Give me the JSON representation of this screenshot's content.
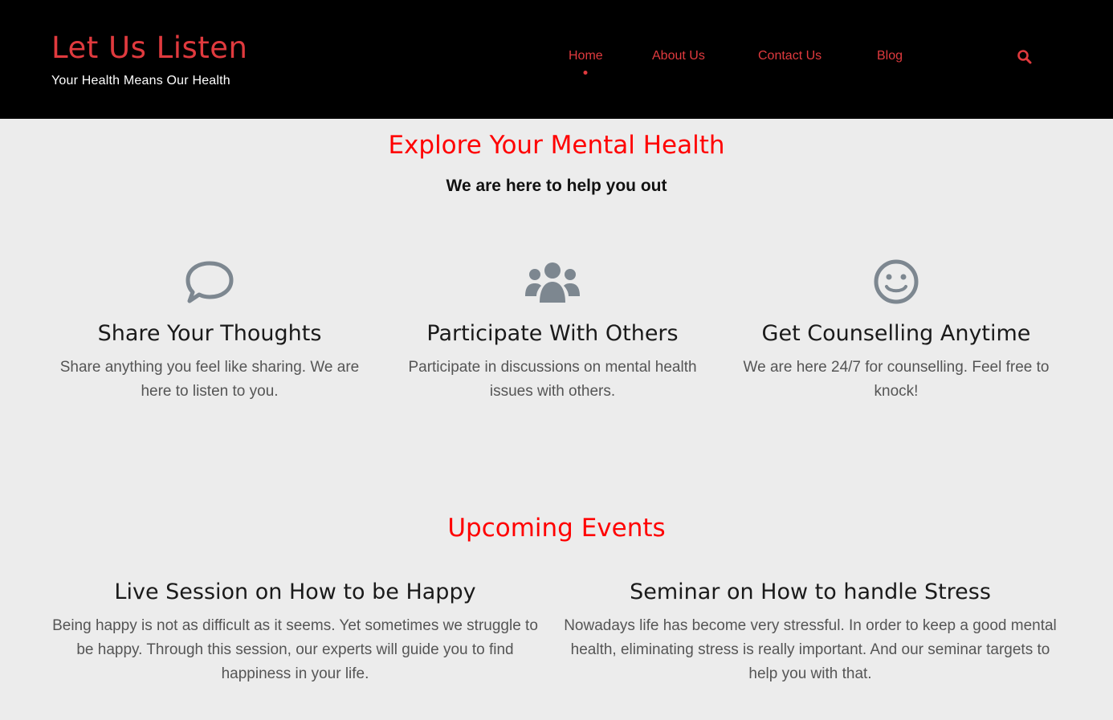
{
  "brand": {
    "title": "Let Us Listen",
    "tagline": "Your Health Means Our Health"
  },
  "nav": {
    "items": [
      {
        "label": "Home",
        "active": true
      },
      {
        "label": "About Us",
        "active": false
      },
      {
        "label": "Contact Us",
        "active": false
      },
      {
        "label": "Blog",
        "active": false
      }
    ],
    "search_icon": "search-icon"
  },
  "explore": {
    "title": "Explore Your Mental Health",
    "subtitle": "We are here to help you out",
    "features": [
      {
        "icon": "speech-bubble-icon",
        "title": "Share Your Thoughts",
        "text": "Share anything you feel like sharing. We are here to listen to you."
      },
      {
        "icon": "users-group-icon",
        "title": "Participate With Others",
        "text": "Participate in discussions on mental health issues with others."
      },
      {
        "icon": "smiley-icon",
        "title": "Get Counselling Anytime",
        "text": "We are here 24/7 for counselling. Feel free to knock!"
      }
    ]
  },
  "events": {
    "title": "Upcoming Events",
    "items": [
      {
        "title": "Live Session on How to be Happy",
        "text": "Being happy is not as difficult as it seems. Yet sometimes we struggle to be happy. Through this session, our experts will guide you to find happiness in your life."
      },
      {
        "title": "Seminar on How to handle Stress",
        "text": "Nowadays life has become very stressful. In order to keep a good mental health, eliminating stress is really important. And our seminar targets to help you with that."
      }
    ]
  },
  "colors": {
    "accent": "#e03a3e",
    "heading_red": "#ff0000",
    "header_bg": "#000000",
    "page_bg": "#ececec",
    "icon_gray": "#7d8790"
  }
}
